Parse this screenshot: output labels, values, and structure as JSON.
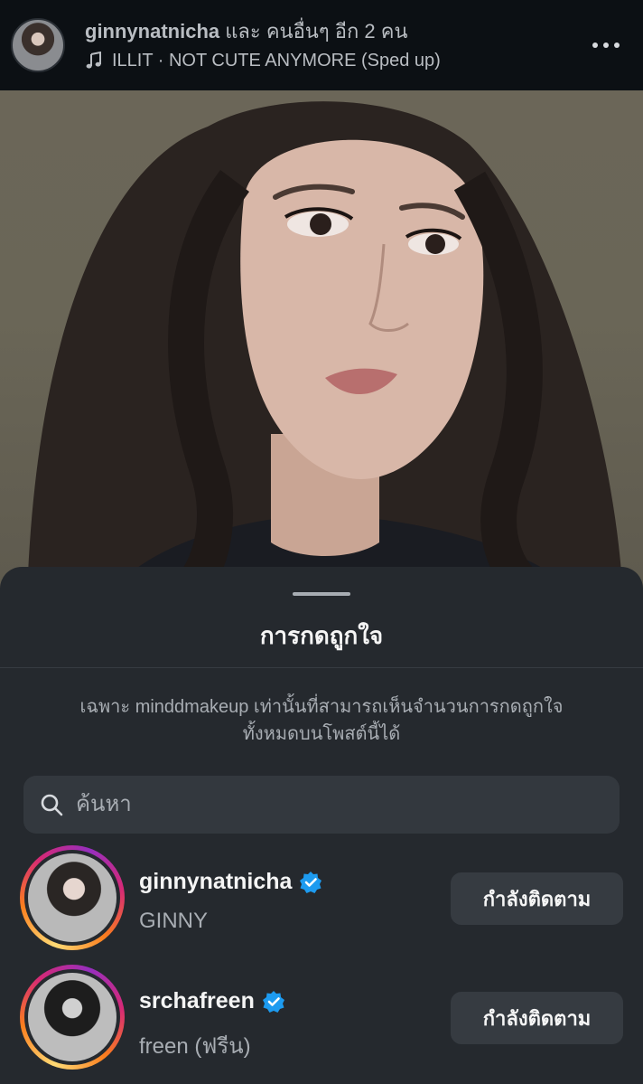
{
  "post_header": {
    "username": "ginnynatnicha",
    "collaborators_text": "และ คนอื่นๆ อีก 2 คน",
    "music_icon": "music-note-icon",
    "music": "ILLIT · NOT CUTE ANYMORE (Sped up)",
    "more_icon": "more-horizontal-icon"
  },
  "likes_sheet": {
    "title": "การกดถูกใจ",
    "notice": "เฉพาะ minddmakeup เท่านั้นที่สามารถเห็นจำนวนการกดถูกใจทั้งหมดบนโพสต์นี้ได้",
    "search": {
      "placeholder": "ค้นหา",
      "value": ""
    },
    "users": [
      {
        "username": "ginnynatnicha",
        "verified": true,
        "full_name": "GINNY",
        "button_label": "กำลังติดตาม"
      },
      {
        "username": "srchafreen",
        "verified": true,
        "full_name": "freen (ฟรีน)",
        "button_label": "กำลังติดตาม"
      }
    ]
  },
  "colors": {
    "background": "#0c1014",
    "sheet": "#25292e",
    "button": "#363b41",
    "verified": "#1d9bf0",
    "muted_text": "#a8adb3"
  }
}
